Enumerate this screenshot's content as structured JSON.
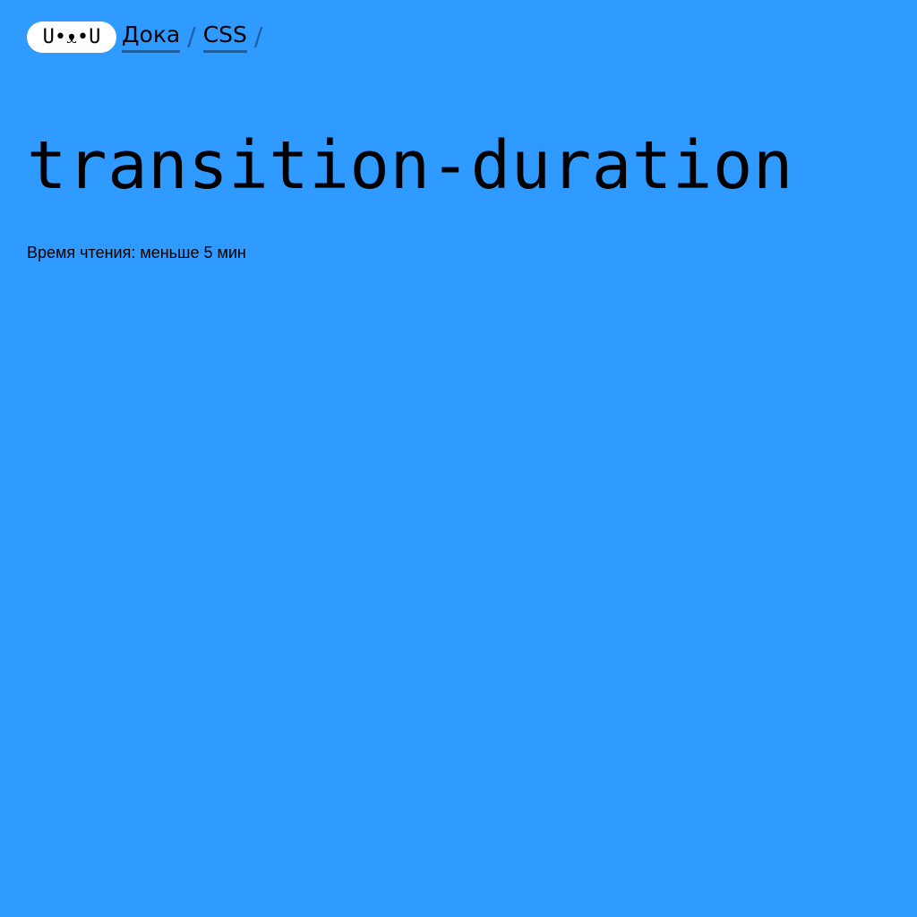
{
  "header": {
    "logo_text": "U•ᴥ•U",
    "breadcrumbs": [
      {
        "label": "Дока"
      },
      {
        "label": "CSS"
      }
    ],
    "separator": "/"
  },
  "article": {
    "title": "transition-duration",
    "reading_time": "Время чтения: меньше 5 мин"
  },
  "colors": {
    "background": "#2f9aff",
    "accent_underline": "#1d5fa0",
    "logo_bg": "#ffffff"
  }
}
